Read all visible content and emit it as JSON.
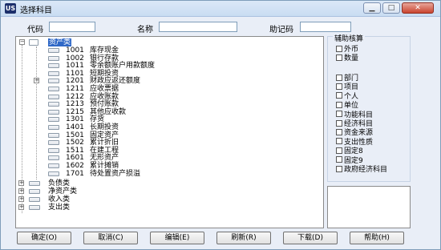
{
  "window": {
    "title": "选择科目",
    "icon_text": "US"
  },
  "search": {
    "code_label": "代码",
    "name_label": "名称",
    "mnemonic_label": "助记码",
    "code_value": "",
    "name_value": "",
    "mnemonic_value": ""
  },
  "tree": {
    "root": "资产类",
    "items": [
      {
        "code": "1001",
        "name": "库存现金"
      },
      {
        "code": "1002",
        "name": "银行存款"
      },
      {
        "code": "1011",
        "name": "零余额账户用款额度"
      },
      {
        "code": "1101",
        "name": "短期投资"
      },
      {
        "code": "1201",
        "name": "财政应返还额度"
      },
      {
        "code": "1211",
        "name": "应收票据"
      },
      {
        "code": "1212",
        "name": "应收账款"
      },
      {
        "code": "1213",
        "name": "预付账款"
      },
      {
        "code": "1215",
        "name": "其他应收款"
      },
      {
        "code": "1301",
        "name": "存货"
      },
      {
        "code": "1401",
        "name": "长期投资"
      },
      {
        "code": "1501",
        "name": "固定资产"
      },
      {
        "code": "1502",
        "name": "累计折旧"
      },
      {
        "code": "1511",
        "name": "在建工程"
      },
      {
        "code": "1601",
        "name": "无形资产"
      },
      {
        "code": "1602",
        "name": "累计摊销"
      },
      {
        "code": "1701",
        "name": "待处置资产损溢"
      }
    ],
    "categories": [
      "负债类",
      "净资产类",
      "收入类",
      "支出类"
    ]
  },
  "aux": {
    "legend": "辅助核算",
    "top_checks": [
      "外币",
      "数量"
    ],
    "checks": [
      "部门",
      "项目",
      "个人",
      "单位",
      "功能科目",
      "经济科目",
      "资金来源",
      "支出性质",
      "固定8",
      "固定9",
      "政府经济科目"
    ]
  },
  "buttons": {
    "confirm": "确定(O)",
    "cancel": "取消(C)",
    "edit": "编辑(E)",
    "refresh": "刷新(R)",
    "download": "下载(D)",
    "help": "帮助(H)"
  }
}
